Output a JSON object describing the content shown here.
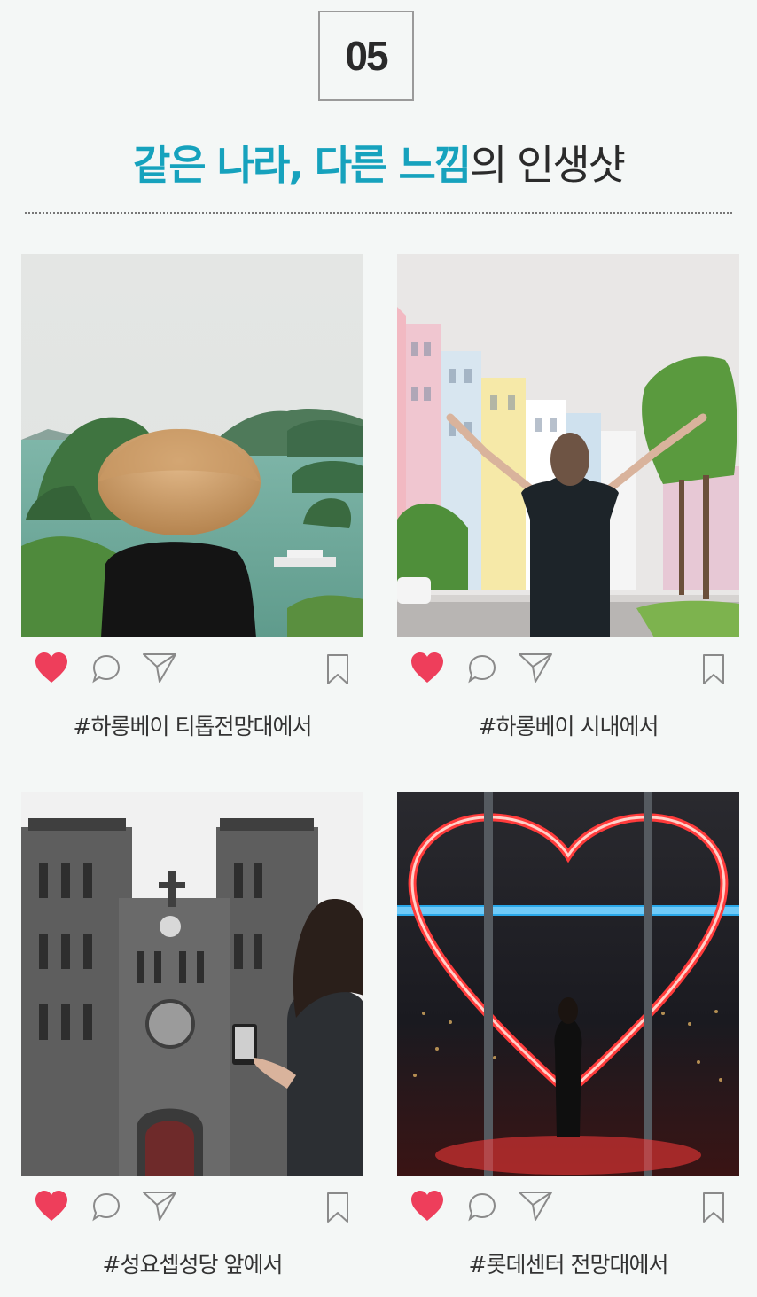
{
  "section_number": "05",
  "headline": {
    "accent": "같은 나라, 다른 느낌",
    "rest": "의 인생샷"
  },
  "colors": {
    "accent": "#16a2bd",
    "heart": "#ee3e5b",
    "icon_outline": "#8a8a8a",
    "background": "#f4f7f6"
  },
  "icons": [
    "heart-icon",
    "comment-icon",
    "share-icon",
    "bookmark-icon"
  ],
  "posts": [
    {
      "caption": "#하롱베이 티톱전망대에서",
      "photo": "person in conical hat overlooking bay islands"
    },
    {
      "caption": "#하롱베이 시내에서",
      "photo": "woman with raised arms on street of colorful buildings"
    },
    {
      "caption": "#성요셉성당 앞에서",
      "photo": "woman photographing gothic cathedral"
    },
    {
      "caption": "#롯데센터 전망대에서",
      "photo": "woman standing inside red neon heart at night view"
    }
  ]
}
